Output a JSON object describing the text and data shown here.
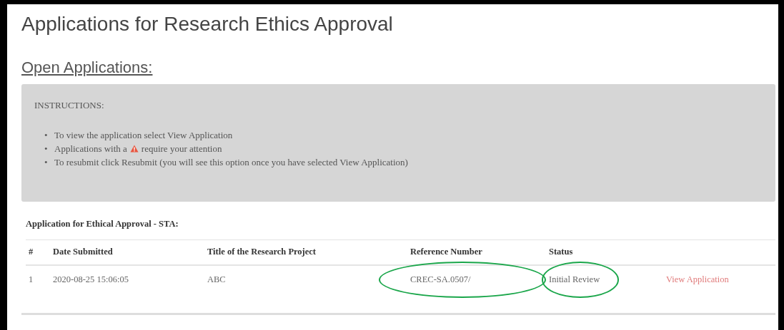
{
  "page": {
    "title": "Applications for Research Ethics Approval",
    "section_heading": "Open Applications:"
  },
  "instructions": {
    "heading": "INSTRUCTIONS:",
    "items": [
      {
        "kind": "text",
        "bullet": "•",
        "text": "To view the application select View Application"
      },
      {
        "kind": "warning",
        "bullet": "•",
        "text_before": "Applications with a",
        "text_after": "require your attention"
      },
      {
        "kind": "text",
        "bullet": "•",
        "text": "To resubmit click Resubmit (you will see this option once you have selected View Application)"
      }
    ]
  },
  "table": {
    "caption": "Application for Ethical Approval - STA:",
    "columns": [
      "#",
      "Date Submitted",
      "Title of the Research Project",
      "Reference Number",
      "Status"
    ],
    "rows": [
      {
        "cells": [
          {
            "kind": "text",
            "text": "1",
            "circled": false
          },
          {
            "kind": "text",
            "text": "2020-08-25 15:06:05",
            "circled": false
          },
          {
            "kind": "text",
            "text": "ABC",
            "circled": false
          },
          {
            "kind": "text",
            "text": "CREC-SA.0507/",
            "circled": true
          },
          {
            "kind": "text",
            "text": "Initial Review",
            "circled": true
          },
          {
            "kind": "link",
            "text": "View Application",
            "circled": false
          }
        ]
      }
    ]
  }
}
